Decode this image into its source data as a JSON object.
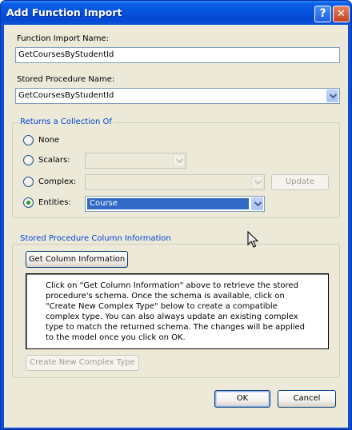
{
  "window": {
    "title": "Add Function Import",
    "help_glyph": "?",
    "close_glyph": "✕"
  },
  "function_import": {
    "label": "Function Import Name:",
    "value": "GetCoursesByStudentId"
  },
  "stored_procedure": {
    "label": "Stored Procedure Name:",
    "value": "GetCoursesByStudentId"
  },
  "returns": {
    "title": "Returns a Collection Of",
    "options": [
      {
        "label": "None",
        "selected": false
      },
      {
        "label": "Scalars:",
        "selected": false,
        "value": ""
      },
      {
        "label": "Complex:",
        "selected": false,
        "value": ""
      },
      {
        "label": "Entities:",
        "selected": true,
        "value": "Course"
      }
    ],
    "update_label": "Update"
  },
  "column_info": {
    "title": "Stored Procedure Column Information",
    "get_button": "Get Column Information",
    "info_text": "Click on \"Get Column Information\" above to retrieve the stored procedure's schema. Once the schema is available, click on \"Create New Complex Type\" below to create a compatible complex type. You can also always update an existing complex type to match the returned schema. The changes will be applied to the model once you click on OK.",
    "create_button": "Create New Complex Type"
  },
  "footer": {
    "ok_label": "OK",
    "cancel_label": "Cancel"
  },
  "colors": {
    "titlebar": "#0553dd",
    "dialog_bg": "#ece9d8",
    "selection": "#316ac5",
    "group_title": "#0046d5"
  }
}
